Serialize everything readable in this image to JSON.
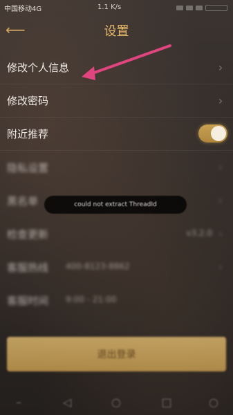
{
  "status_bar": {
    "carrier": "中国移动4G",
    "speed": "1.1 K/s"
  },
  "header": {
    "title": "设置"
  },
  "settings": [
    {
      "label": "修改个人信息"
    },
    {
      "label": "修改密码"
    },
    {
      "label": "附近推荐",
      "toggle": true
    }
  ],
  "blurred_rows": [
    {
      "label": "隐私设置",
      "value": ""
    },
    {
      "label": "黑名单",
      "value": ""
    },
    {
      "label": "检查更新",
      "value": "v3.2.0",
      "value_side": "right"
    },
    {
      "label": "客服热线",
      "value": "400-8123-8862"
    },
    {
      "label": "客服时间",
      "value": "9:00 - 21:00"
    }
  ],
  "toast": {
    "text": "could not extract ThreadId"
  },
  "logout": {
    "label": "退出登录"
  },
  "annotation": {
    "arrow_color": "#e0457f"
  },
  "colors": {
    "accent": "#e6b96a",
    "toggle_on": "#c8a153"
  }
}
